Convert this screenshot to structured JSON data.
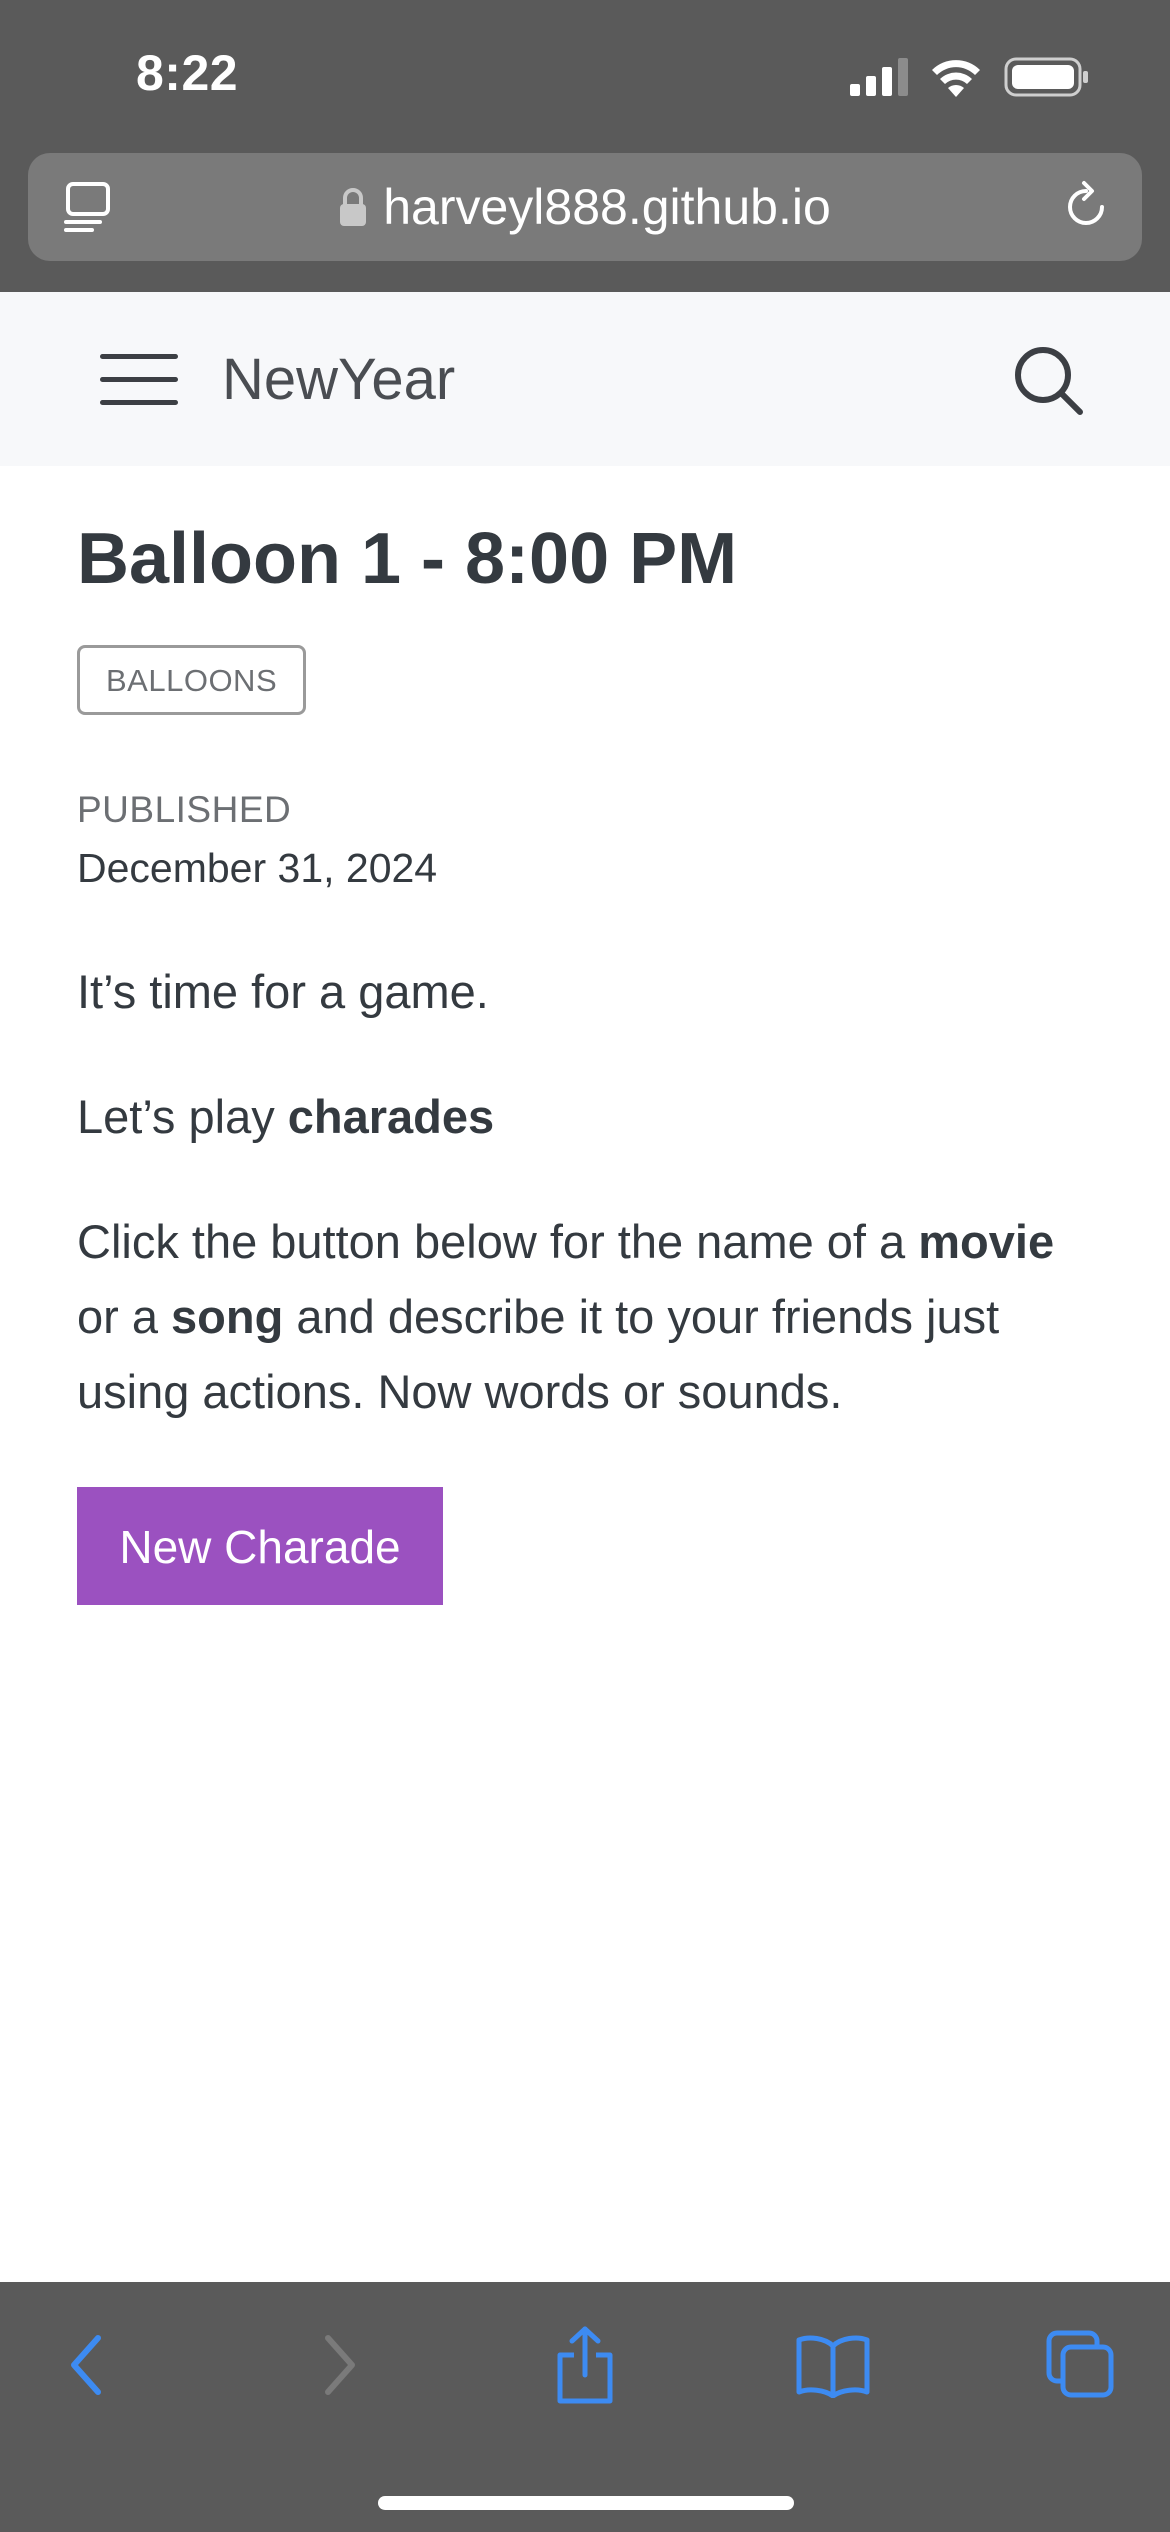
{
  "status_bar": {
    "time": "8:22",
    "signal_icon": "cellular-signal-icon",
    "wifi_icon": "wifi-icon",
    "battery_icon": "battery-icon"
  },
  "browser": {
    "url": "harveyl888.github.io",
    "lock_icon": "lock-icon",
    "reader_icon": "reader-mode-icon",
    "reload_icon": "reload-icon"
  },
  "site": {
    "title": "NewYear",
    "menu_icon": "hamburger-menu-icon",
    "search_icon": "search-icon"
  },
  "post": {
    "title": "Balloon 1 - 8:00 PM",
    "tag": "BALLOONS",
    "published_label": "PUBLISHED",
    "published_date": "December 31, 2024",
    "para1": "It’s time for a game.",
    "para2_prefix": "Let’s play ",
    "para2_bold": "charades",
    "para3_part1": "Click the button below for the name of a ",
    "para3_bold1": "movie",
    "para3_part2": " or a ",
    "para3_bold2": "song",
    "para3_part3": " and describe it to your friends just using actions. Now words or sounds.",
    "button_label": "New Charade"
  },
  "toolbar": {
    "back_icon": "back-chevron-icon",
    "forward_icon": "forward-chevron-icon",
    "share_icon": "share-icon",
    "bookmarks_icon": "bookmarks-book-icon",
    "tabs_icon": "tabs-icon"
  },
  "colors": {
    "chrome": "#5a5a5a",
    "accent_button": "#9b51c0",
    "toolbar_blue": "#3d8bf2",
    "text_dark": "#343a40"
  }
}
